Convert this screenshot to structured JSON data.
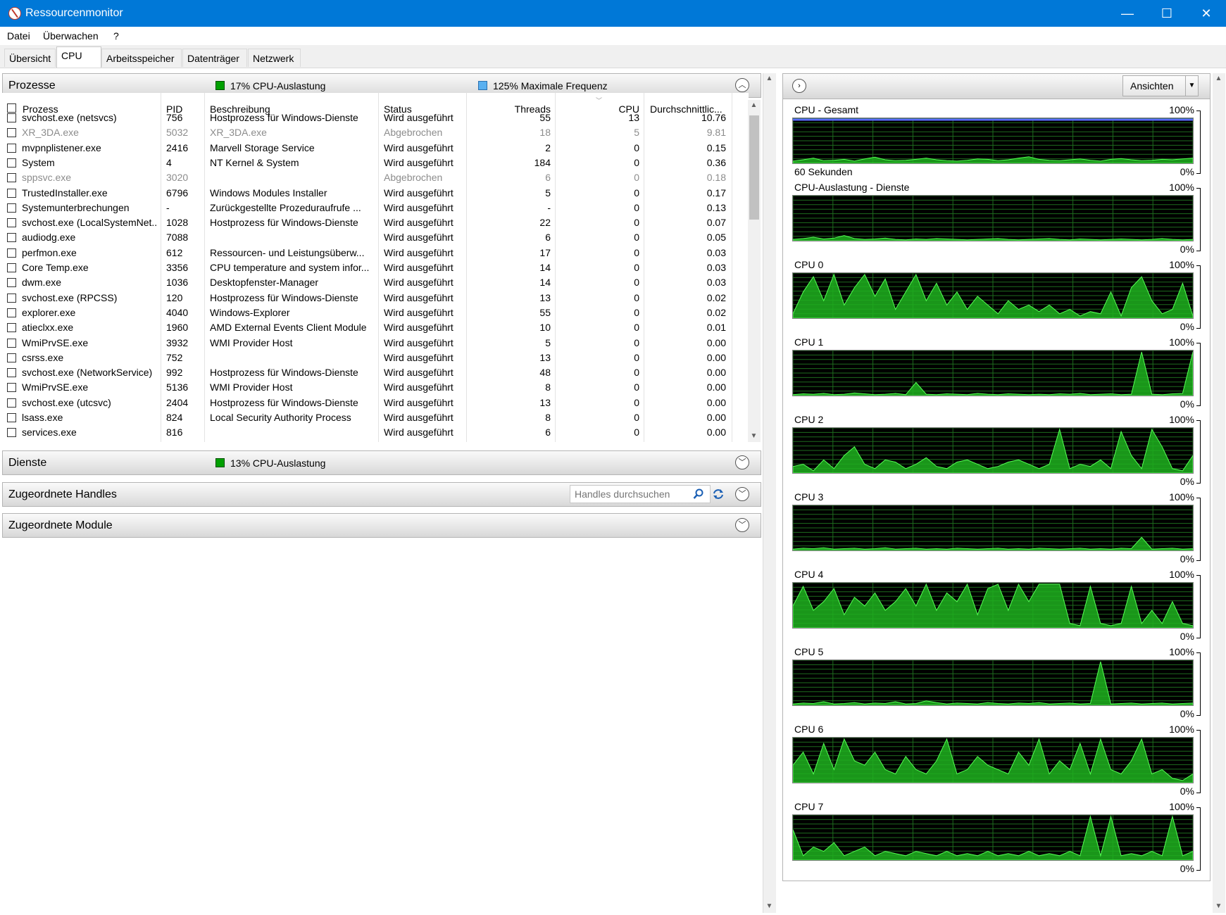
{
  "window": {
    "title": "Ressourcenmonitor",
    "minimize": "—",
    "maximize": "☐",
    "close": "✕"
  },
  "menu": [
    "Datei",
    "Überwachen",
    "?"
  ],
  "tabs": [
    "Übersicht",
    "CPU",
    "Arbeitsspeicher",
    "Datenträger",
    "Netzwerk"
  ],
  "active_tab": "CPU",
  "processes": {
    "title": "Prozesse",
    "cpu_usage": "17% CPU-Auslastung",
    "max_freq": "125% Maximale Frequenz",
    "columns": [
      "Prozess",
      "PID",
      "Beschreibung",
      "Status",
      "Threads",
      "CPU",
      "Durchschnittlic..."
    ],
    "rows": [
      {
        "name": "svchost.exe (netsvcs)",
        "pid": "756",
        "desc": "Hostprozess für Windows-Dienste",
        "status": "Wird ausgeführt",
        "threads": "55",
        "cpu": "13",
        "avg": "10.76",
        "gray": false
      },
      {
        "name": "XR_3DA.exe",
        "pid": "5032",
        "desc": "XR_3DA.exe",
        "status": "Abgebrochen",
        "threads": "18",
        "cpu": "5",
        "avg": "9.81",
        "gray": true
      },
      {
        "name": "mvpnplistener.exe",
        "pid": "2416",
        "desc": "Marvell Storage Service",
        "status": "Wird ausgeführt",
        "threads": "2",
        "cpu": "0",
        "avg": "0.15",
        "gray": false
      },
      {
        "name": "System",
        "pid": "4",
        "desc": "NT Kernel & System",
        "status": "Wird ausgeführt",
        "threads": "184",
        "cpu": "0",
        "avg": "0.36",
        "gray": false
      },
      {
        "name": "sppsvc.exe",
        "pid": "3020",
        "desc": "",
        "status": "Abgebrochen",
        "threads": "6",
        "cpu": "0",
        "avg": "0.18",
        "gray": true
      },
      {
        "name": "TrustedInstaller.exe",
        "pid": "6796",
        "desc": "Windows Modules Installer",
        "status": "Wird ausgeführt",
        "threads": "5",
        "cpu": "0",
        "avg": "0.17",
        "gray": false
      },
      {
        "name": "Systemunterbrechungen",
        "pid": "-",
        "desc": "Zurückgestellte Prozeduraufrufe ...",
        "status": "Wird ausgeführt",
        "threads": "-",
        "cpu": "0",
        "avg": "0.13",
        "gray": false
      },
      {
        "name": "svchost.exe (LocalSystemNet...",
        "pid": "1028",
        "desc": "Hostprozess für Windows-Dienste",
        "status": "Wird ausgeführt",
        "threads": "22",
        "cpu": "0",
        "avg": "0.07",
        "gray": false
      },
      {
        "name": "audiodg.exe",
        "pid": "7088",
        "desc": "",
        "status": "Wird ausgeführt",
        "threads": "6",
        "cpu": "0",
        "avg": "0.05",
        "gray": false
      },
      {
        "name": "perfmon.exe",
        "pid": "612",
        "desc": "Ressourcen- und Leistungsüberw...",
        "status": "Wird ausgeführt",
        "threads": "17",
        "cpu": "0",
        "avg": "0.03",
        "gray": false
      },
      {
        "name": "Core Temp.exe",
        "pid": "3356",
        "desc": "CPU temperature and system infor...",
        "status": "Wird ausgeführt",
        "threads": "14",
        "cpu": "0",
        "avg": "0.03",
        "gray": false
      },
      {
        "name": "dwm.exe",
        "pid": "1036",
        "desc": "Desktopfenster-Manager",
        "status": "Wird ausgeführt",
        "threads": "14",
        "cpu": "0",
        "avg": "0.03",
        "gray": false
      },
      {
        "name": "svchost.exe (RPCSS)",
        "pid": "120",
        "desc": "Hostprozess für Windows-Dienste",
        "status": "Wird ausgeführt",
        "threads": "13",
        "cpu": "0",
        "avg": "0.02",
        "gray": false
      },
      {
        "name": "explorer.exe",
        "pid": "4040",
        "desc": "Windows-Explorer",
        "status": "Wird ausgeführt",
        "threads": "55",
        "cpu": "0",
        "avg": "0.02",
        "gray": false
      },
      {
        "name": "atieclxx.exe",
        "pid": "1960",
        "desc": "AMD External Events Client Module",
        "status": "Wird ausgeführt",
        "threads": "10",
        "cpu": "0",
        "avg": "0.01",
        "gray": false
      },
      {
        "name": "WmiPrvSE.exe",
        "pid": "3932",
        "desc": "WMI Provider Host",
        "status": "Wird ausgeführt",
        "threads": "5",
        "cpu": "0",
        "avg": "0.00",
        "gray": false
      },
      {
        "name": "csrss.exe",
        "pid": "752",
        "desc": "",
        "status": "Wird ausgeführt",
        "threads": "13",
        "cpu": "0",
        "avg": "0.00",
        "gray": false
      },
      {
        "name": "svchost.exe (NetworkService)",
        "pid": "992",
        "desc": "Hostprozess für Windows-Dienste",
        "status": "Wird ausgeführt",
        "threads": "48",
        "cpu": "0",
        "avg": "0.00",
        "gray": false
      },
      {
        "name": "WmiPrvSE.exe",
        "pid": "5136",
        "desc": "WMI Provider Host",
        "status": "Wird ausgeführt",
        "threads": "8",
        "cpu": "0",
        "avg": "0.00",
        "gray": false
      },
      {
        "name": "svchost.exe (utcsvc)",
        "pid": "2404",
        "desc": "Hostprozess für Windows-Dienste",
        "status": "Wird ausgeführt",
        "threads": "13",
        "cpu": "0",
        "avg": "0.00",
        "gray": false
      },
      {
        "name": "lsass.exe",
        "pid": "824",
        "desc": "Local Security Authority Process",
        "status": "Wird ausgeführt",
        "threads": "8",
        "cpu": "0",
        "avg": "0.00",
        "gray": false
      },
      {
        "name": "services.exe",
        "pid": "816",
        "desc": "",
        "status": "Wird ausgeführt",
        "threads": "6",
        "cpu": "0",
        "avg": "0.00",
        "gray": false
      }
    ]
  },
  "services": {
    "title": "Dienste",
    "cpu_usage": "13% CPU-Auslastung"
  },
  "handles": {
    "title": "Zugeordnete Handles",
    "search_placeholder": "Handles durchsuchen"
  },
  "modules": {
    "title": "Zugeordnete Module"
  },
  "graphs_pane": {
    "views_label": "Ansichten",
    "time_label": "60 Sekunden",
    "max_label": "100%",
    "min_label": "0%",
    "graphs": [
      {
        "title": "CPU - Gesamt",
        "values": [
          5,
          8,
          12,
          6,
          7,
          9,
          5,
          10,
          14,
          8,
          6,
          7,
          9,
          12,
          8,
          6,
          5,
          7,
          10,
          9,
          6,
          8,
          12,
          15,
          9,
          7,
          6,
          8,
          10,
          7,
          5,
          9,
          11,
          8,
          6,
          7,
          9,
          8,
          10,
          12
        ]
      },
      {
        "title": "CPU-Auslastung - Dienste",
        "values": [
          3,
          5,
          8,
          4,
          6,
          12,
          5,
          3,
          4,
          6,
          3,
          2,
          4,
          3,
          5,
          4,
          3,
          2,
          3,
          4,
          5,
          3,
          2,
          3,
          4,
          5,
          3,
          2,
          4,
          3,
          2,
          3,
          4,
          3,
          2,
          3,
          5,
          3,
          2,
          3
        ]
      },
      {
        "title": "CPU 0",
        "values": [
          10,
          60,
          95,
          40,
          100,
          30,
          70,
          100,
          50,
          90,
          20,
          60,
          100,
          40,
          80,
          30,
          60,
          20,
          50,
          30,
          10,
          40,
          20,
          30,
          15,
          30,
          10,
          20,
          5,
          15,
          10,
          60,
          5,
          70,
          95,
          40,
          10,
          20,
          80,
          5
        ]
      },
      {
        "title": "CPU 1",
        "values": [
          2,
          4,
          3,
          5,
          2,
          3,
          6,
          4,
          2,
          3,
          5,
          2,
          30,
          3,
          2,
          4,
          3,
          2,
          5,
          3,
          2,
          4,
          3,
          2,
          3,
          2,
          4,
          3,
          5,
          2,
          3,
          4,
          2,
          3,
          100,
          3,
          2,
          4,
          5,
          100
        ]
      },
      {
        "title": "CPU 2",
        "values": [
          15,
          20,
          5,
          30,
          10,
          40,
          60,
          20,
          10,
          30,
          25,
          10,
          20,
          35,
          15,
          10,
          25,
          30,
          20,
          10,
          15,
          25,
          30,
          20,
          10,
          20,
          100,
          10,
          20,
          15,
          30,
          10,
          95,
          40,
          10,
          100,
          60,
          10,
          5,
          40
        ]
      },
      {
        "title": "CPU 3",
        "values": [
          3,
          5,
          4,
          6,
          3,
          4,
          5,
          3,
          4,
          6,
          3,
          4,
          5,
          3,
          4,
          3,
          5,
          4,
          3,
          4,
          5,
          3,
          4,
          3,
          5,
          4,
          3,
          4,
          5,
          3,
          4,
          3,
          5,
          4,
          30,
          3,
          4,
          5,
          3,
          4
        ]
      },
      {
        "title": "CPU 4",
        "values": [
          50,
          95,
          40,
          60,
          90,
          30,
          70,
          50,
          80,
          40,
          60,
          90,
          50,
          100,
          40,
          80,
          60,
          100,
          30,
          90,
          100,
          40,
          100,
          60,
          100,
          100,
          100,
          10,
          5,
          95,
          10,
          5,
          10,
          95,
          10,
          40,
          10,
          60,
          10,
          5
        ]
      },
      {
        "title": "CPU 5",
        "values": [
          3,
          5,
          4,
          8,
          3,
          4,
          6,
          3,
          5,
          4,
          8,
          3,
          4,
          10,
          6,
          3,
          5,
          4,
          3,
          6,
          4,
          3,
          5,
          4,
          6,
          3,
          4,
          5,
          3,
          4,
          100,
          3,
          4,
          5,
          3,
          4,
          5,
          3,
          4,
          5
        ]
      },
      {
        "title": "CPU 6",
        "values": [
          40,
          70,
          20,
          90,
          30,
          100,
          50,
          40,
          70,
          30,
          20,
          60,
          30,
          20,
          50,
          100,
          20,
          30,
          60,
          40,
          30,
          20,
          70,
          40,
          100,
          20,
          50,
          30,
          90,
          20,
          100,
          30,
          20,
          50,
          100,
          20,
          30,
          10,
          5,
          20
        ]
      },
      {
        "title": "CPU 7",
        "values": [
          70,
          10,
          30,
          20,
          40,
          10,
          20,
          30,
          10,
          20,
          15,
          10,
          20,
          15,
          10,
          20,
          10,
          15,
          10,
          20,
          10,
          15,
          10,
          20,
          10,
          15,
          10,
          20,
          10,
          100,
          10,
          100,
          10,
          15,
          10,
          20,
          10,
          100,
          10,
          20
        ]
      }
    ]
  }
}
